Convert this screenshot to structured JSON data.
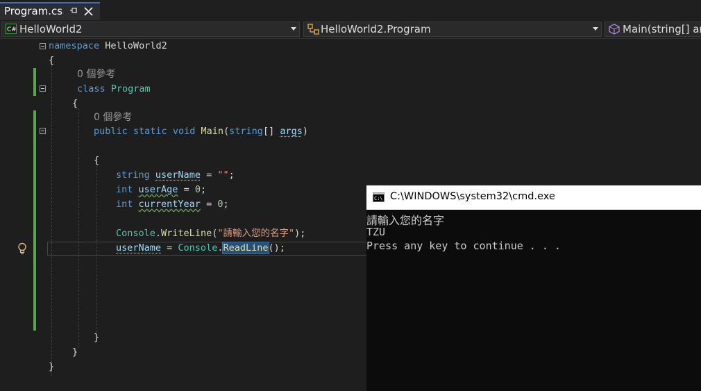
{
  "tab": {
    "filename": "Program.cs"
  },
  "navbar": {
    "project": "HelloWorld2",
    "class": "HelloWorld2.Program",
    "member": "Main(string[] args)"
  },
  "code": {
    "ns_keyword": "namespace",
    "ns_name": "HelloWorld2",
    "ref_count_1": "0 個參考",
    "ref_count_2": "0 個參考",
    "class_keyword": "class",
    "class_name": "Program",
    "kw_public": "public",
    "kw_static": "static",
    "kw_void": "void",
    "method_name": "Main",
    "kw_string": "string",
    "param_name": "args",
    "kw_string2": "string",
    "var_username": "userName",
    "empty_string": "\"\"",
    "kw_int1": "int",
    "var_userage": "userAge",
    "zero1": "0",
    "kw_int2": "int",
    "var_currentyear": "currentYear",
    "zero2": "0",
    "console1": "Console",
    "writeline": "WriteLine",
    "prompt_string": "\"請輸入您的名字\"",
    "var_username2": "userName",
    "console2": "Console",
    "readline": "ReadLine"
  },
  "console": {
    "title": "C:\\WINDOWS\\system32\\cmd.exe",
    "lines": [
      "請輸入您的名字",
      "TZU",
      "Press any key to continue . . ."
    ]
  },
  "colors": {
    "keyword": "#569cd6",
    "type": "#4ec9b0",
    "method": "#dcdcaa",
    "string": "#d69d85",
    "number": "#b5cea8",
    "variable": "#9cdcfe",
    "change_bar": "#57a64a",
    "tab_accent": "#3f6fd0"
  }
}
